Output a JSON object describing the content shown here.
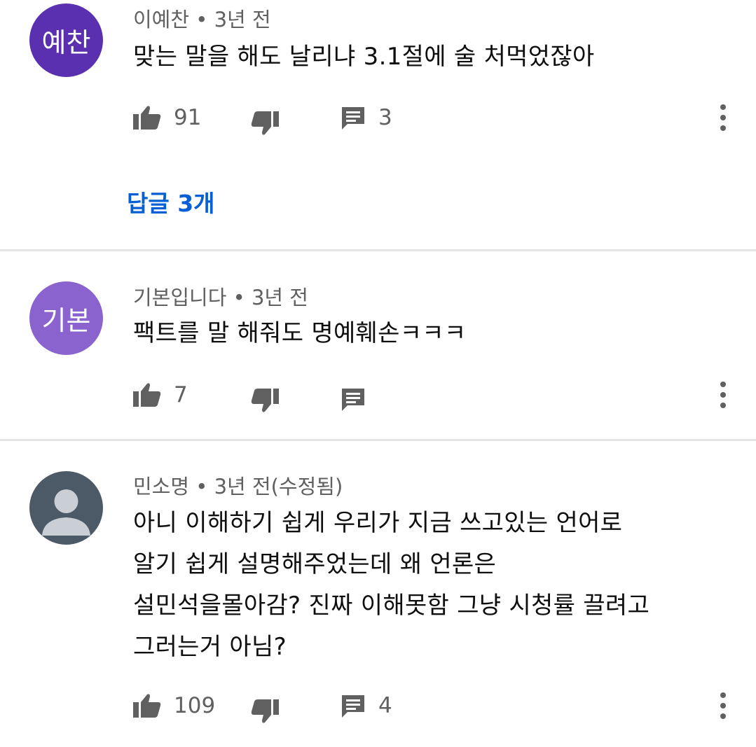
{
  "comments": [
    {
      "avatar_text": "예찬",
      "avatar_color": "#5b30b0",
      "author": "이예찬",
      "time": "3년 전",
      "text": [
        "맞는 말을 해도 날리냐 3.1절에 술 처먹었잖아"
      ],
      "likes": "91",
      "replies_count": "3",
      "replies_link": "답글 3개"
    },
    {
      "avatar_text": "기본",
      "avatar_color": "#8a63cf",
      "author": "기본입니다",
      "time": "3년 전",
      "text": [
        "팩트를 말 해줘도 명예훼손ㅋㅋㅋ"
      ],
      "likes": "7",
      "replies_count": ""
    },
    {
      "avatar_text": "",
      "avatar_color": "#4b5a66",
      "author": "민소명",
      "time": "3년 전(수정됨)",
      "text": [
        "아니 이해하기 쉽게 우리가 지금 쓰고있는 언어로",
        "알기 쉽게 설명해주었는데 왜 언론은",
        "설민석을몰아감? 진짜 이해못함 그냥 시청률 끌려고",
        "그러는거 아님?"
      ],
      "likes": "109",
      "replies_count": "4"
    }
  ],
  "separator": "•",
  "icons": {
    "like": "thumb-up-icon",
    "dislike": "thumb-down-icon",
    "reply": "comment-icon",
    "more": "more-vert-icon"
  },
  "colors": {
    "text": "#0f0f0f",
    "secondary": "#606060",
    "link": "#065fd4",
    "divider": "#e5e5e5"
  }
}
